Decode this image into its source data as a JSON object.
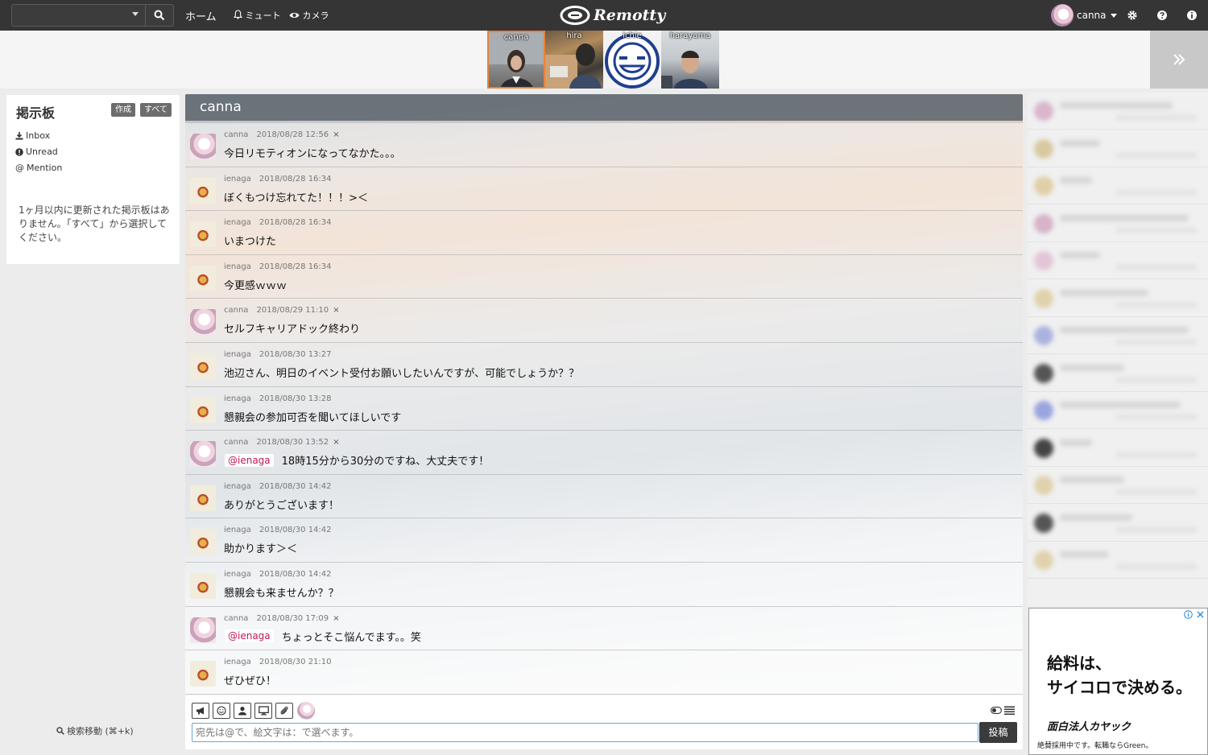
{
  "app": {
    "name": "Remotty"
  },
  "navbar": {
    "home_label": "ホーム",
    "mute_label": "ミュート",
    "camera_label": "カメラ",
    "user_name": "canna",
    "icons": [
      "search-icon",
      "bell-icon",
      "eye-icon",
      "gear-icon",
      "question-icon",
      "info-icon"
    ]
  },
  "cameras": [
    {
      "label": "canna",
      "active": true
    },
    {
      "label": "hira"
    },
    {
      "label": "ichie"
    },
    {
      "label": "harayama"
    }
  ],
  "board": {
    "title": "掲示板",
    "create_label": "作成",
    "all_label": "すべて",
    "items": [
      {
        "label": "Inbox",
        "icon": "download-icon"
      },
      {
        "label": "Unread",
        "icon": "exclamation-icon"
      },
      {
        "label": "Mention",
        "icon": "at-icon"
      }
    ],
    "empty_message": "1ヶ月以内に更新された掲示板はありません。「すべて」から選択してください。"
  },
  "search_move_label": "検索移動 (⌘+k)",
  "chat": {
    "title": "canna",
    "messages": [
      {
        "user": "canna",
        "date": "2018/08/28 12:56",
        "deletable": "×",
        "mention": "",
        "text": "今日リモティオンになってなかた。。。"
      },
      {
        "user": "ienaga",
        "date": "2018/08/28 16:34",
        "deletable": "",
        "mention": "",
        "text": "ぼくもつけ忘れてた！！！>＜"
      },
      {
        "user": "ienaga",
        "date": "2018/08/28 16:34",
        "deletable": "",
        "mention": "",
        "text": "いまつけた"
      },
      {
        "user": "ienaga",
        "date": "2018/08/28 16:34",
        "deletable": "",
        "mention": "",
        "text": "今更感ｗｗｗ"
      },
      {
        "user": "canna",
        "date": "2018/08/29 11:10",
        "deletable": "×",
        "mention": "",
        "text": "セルフキャリアドック終わり"
      },
      {
        "user": "ienaga",
        "date": "2018/08/30 13:27",
        "deletable": "",
        "mention": "",
        "text": "池辺さん、明日のイベント受付お願いしたいんですが、可能でしょうか？？"
      },
      {
        "user": "ienaga",
        "date": "2018/08/30 13:28",
        "deletable": "",
        "mention": "",
        "text": "懇親会の参加可否を聞いてほしいです"
      },
      {
        "user": "canna",
        "date": "2018/08/30 13:52",
        "deletable": "×",
        "mention": "@ienaga",
        "text": "18時15分から30分のですね、大丈夫です！"
      },
      {
        "user": "ienaga",
        "date": "2018/08/30 14:42",
        "deletable": "",
        "mention": "",
        "text": "ありがとうございます！"
      },
      {
        "user": "ienaga",
        "date": "2018/08/30 14:42",
        "deletable": "",
        "mention": "",
        "text": "助かります＞＜"
      },
      {
        "user": "ienaga",
        "date": "2018/08/30 14:42",
        "deletable": "",
        "mention": "",
        "text": "懇親会も来ませんか？？"
      },
      {
        "user": "canna",
        "date": "2018/08/30 17:09",
        "deletable": "×",
        "mention": "@ienaga",
        "text": "ちょっとそこ悩んでます。。笑"
      },
      {
        "user": "ienaga",
        "date": "2018/08/30 21:10",
        "deletable": "",
        "mention": "",
        "text": "ぜひぜひ！"
      }
    ]
  },
  "composer": {
    "placeholder": "宛先は@で、絵文字は：で選べます。",
    "post_label": "投稿",
    "tools": [
      "megaphone-icon",
      "smile-icon",
      "user-icon",
      "monitor-icon",
      "paperclip-icon"
    ]
  },
  "ad": {
    "line1": "給料は、",
    "line2": "サイコロで決める。",
    "company": "面白法人カヤック",
    "footer": "絶賛採用中です。転職ならGreen。"
  },
  "colors": {
    "navbar": "#353535",
    "active_camera_border": "#e8833a",
    "mention_text": "#c2185b",
    "input_border": "#6aa7d8"
  }
}
